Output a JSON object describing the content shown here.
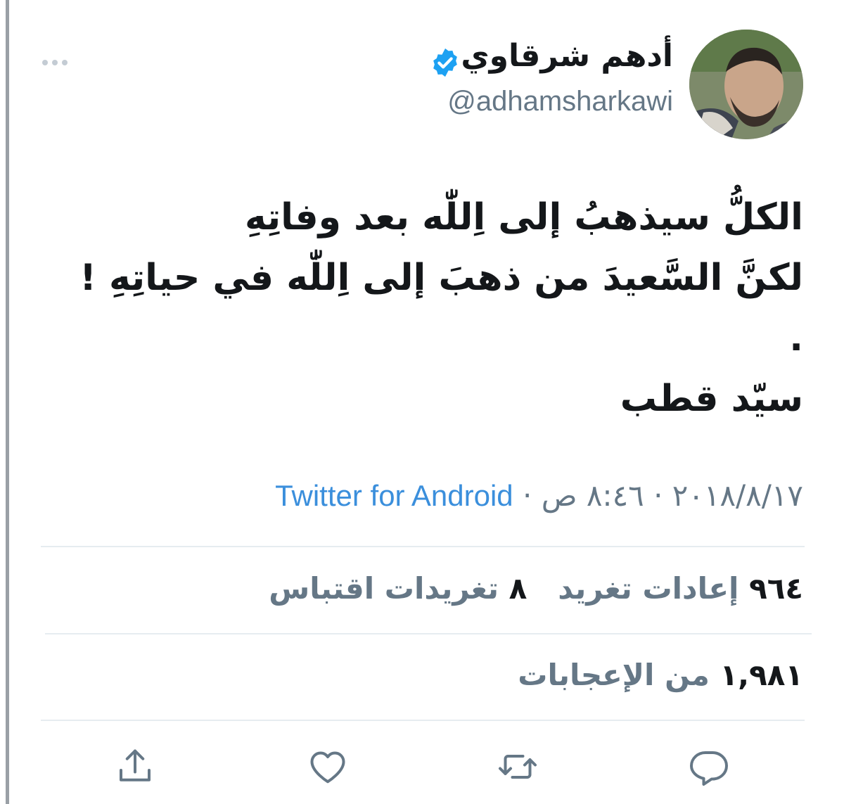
{
  "author": {
    "display_name": "أدهم شرقاوي",
    "handle": "@adhamsharkawi",
    "verified": true
  },
  "tweet": {
    "lines": [
      "الكلُّ سيذهبُ إلى اِللّٰه بعد وفاتِهِ",
      "لكنَّ السَّعيدَ من ذهبَ إلى اِللّٰه في حياتِهِ !",
      ".",
      "سيّد قطب"
    ]
  },
  "meta": {
    "date": "٢٠١٨/٨/١٧",
    "time": "٨:٤٦ ص",
    "separator": "·",
    "source": "Twitter for Android"
  },
  "stats": {
    "retweets_count": "٩٦٤",
    "retweets_label": "إعادات تغريد",
    "quotes_count": "٨",
    "quotes_label": "تغريدات اقتباس",
    "likes_count": "١,٩٨١",
    "likes_label": "من الإعجابات"
  },
  "icons": {
    "more": "more-horizontal-icon",
    "verified": "verified-badge-icon",
    "reply": "reply-icon",
    "retweet": "retweet-icon",
    "like": "heart-icon",
    "share": "share-icon"
  },
  "colors": {
    "accent": "#1da1f2",
    "link": "#3b8fdc",
    "secondary_text": "#657786",
    "primary_text": "#14171a",
    "divider": "#e6ecf0"
  }
}
